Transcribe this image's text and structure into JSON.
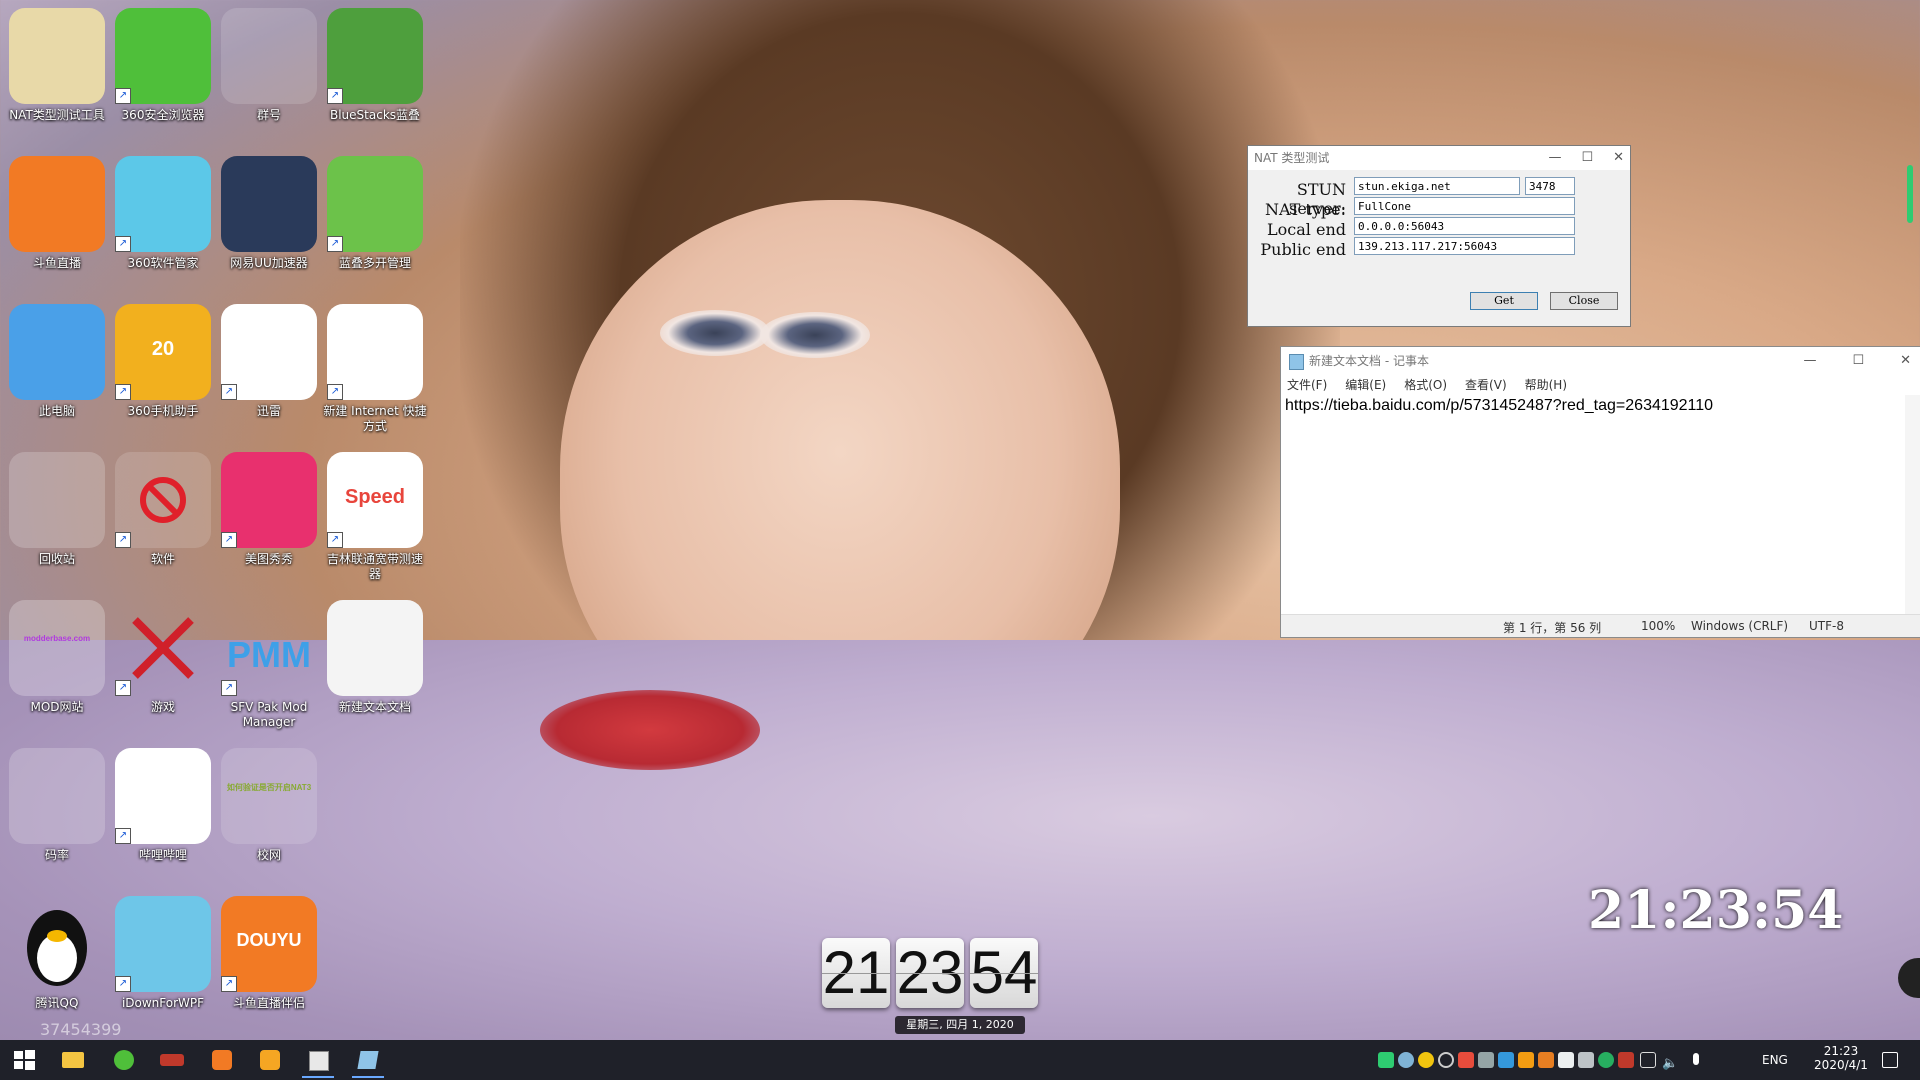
{
  "desktop": {
    "icons": [
      {
        "label": "NAT类型测试工具",
        "color": "#e8d9a8"
      },
      {
        "label": "360安全浏览器",
        "color": "#4fbf3a"
      },
      {
        "label": "群号",
        "color": "rgba(255,255,255,0.15)"
      },
      {
        "label": "BlueStacks蓝叠",
        "color": "#4e9f3d"
      },
      {
        "label": "斗鱼直播",
        "color": "#f27a24"
      },
      {
        "label": "360软件管家",
        "color": "#5cc8e8"
      },
      {
        "label": "网易UU加速器",
        "color": "#2a3a5a"
      },
      {
        "label": "蓝叠多开管理",
        "color": "#6cc24a"
      },
      {
        "label": "此电脑",
        "color": "#4aa0e8"
      },
      {
        "label": "360手机助手",
        "color": "#f2b01e"
      },
      {
        "label": "迅雷",
        "color": "#ffffff"
      },
      {
        "label": "新建 Internet 快捷方式",
        "color": "#ffffff"
      },
      {
        "label": "回收站",
        "color": "rgba(255,255,255,0.2)"
      },
      {
        "label": "软件",
        "color": "rgba(255,255,255,0.15)"
      },
      {
        "label": "美图秀秀",
        "color": "#e8306e"
      },
      {
        "label": "吉林联通宽带测速器",
        "color": "#ffffff"
      },
      {
        "label": "MOD网站",
        "color": "rgba(255,255,255,0.25)"
      },
      {
        "label": "游戏",
        "color": "rgba(255,255,255,0.0)"
      },
      {
        "label": "SFV Pak Mod Manager",
        "color": "rgba(255,255,255,0.0)"
      },
      {
        "label": "新建文本文档",
        "color": "#f4f4f4"
      },
      {
        "label": "码率",
        "color": "rgba(255,255,255,0.2)"
      },
      {
        "label": "哔哩哔哩",
        "color": "#ffffff"
      },
      {
        "label": "校网",
        "color": "rgba(255,255,255,0.15)"
      },
      {
        "label": "腾讯QQ",
        "color": "rgba(255,255,255,0.0)"
      },
      {
        "label": "iDownForWPF",
        "color": "#6ec6e8"
      },
      {
        "label": "斗鱼直播伴侣",
        "color": "#f27a24"
      }
    ],
    "qq_number": "37454399",
    "icon_text": {
      "pmm": "PMM",
      "speed": "Speed",
      "badge": "20",
      "douyu": "DOUYU",
      "mod_thumb": "modderbase.com",
      "bili_thumb": "如何验证是否开启NAT3"
    }
  },
  "nat_window": {
    "title": "NAT 类型测试",
    "stun_label": "STUN server:",
    "stun_value": "stun.ekiga.net",
    "port_value": "3478",
    "type_label": "NAT type:",
    "type_value": "FullCone",
    "local_label": "Local end",
    "local_value": "0.0.0.0:56043",
    "public_label": "Public end",
    "public_value": "139.213.117.217:56043",
    "get_label": "Get",
    "close_label": "Close"
  },
  "notepad": {
    "title": "新建文本文档 - 记事本",
    "menu": [
      "文件(F)",
      "编辑(E)",
      "格式(O)",
      "查看(V)",
      "帮助(H)"
    ],
    "content": "https://tieba.baidu.com/p/5731452487?red_tag=2634192110",
    "status_pos": "第 1 行，第 56 列",
    "status_zoom": "100%",
    "status_eol": "Windows (CRLF)",
    "status_enc": "UTF-8"
  },
  "clock": {
    "big_time": "21:23:54",
    "flip_h": "21",
    "flip_m": "23",
    "flip_s": "54",
    "flip_date": "星期三, 四月 1, 2020"
  },
  "taskbar": {
    "lang": "ENG",
    "time": "21:23",
    "date": "2020/4/1"
  }
}
